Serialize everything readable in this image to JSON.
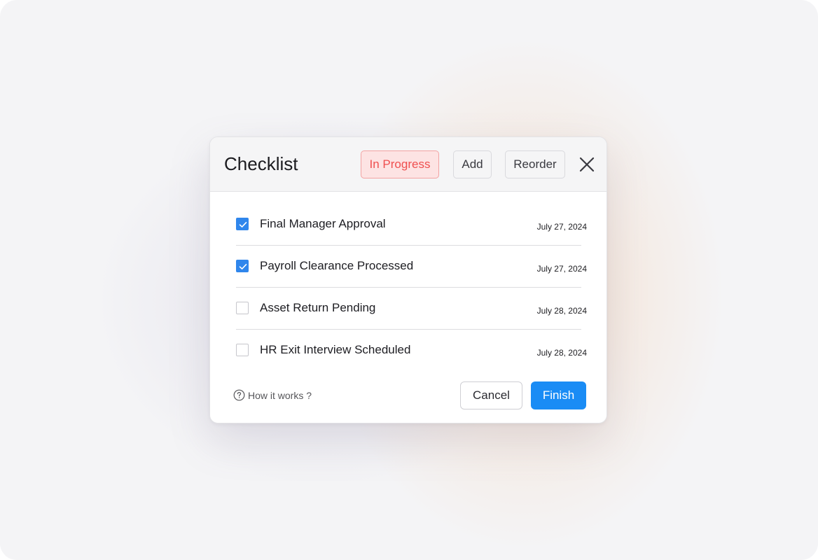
{
  "dialog": {
    "title": "Checklist",
    "status_label": "In Progress",
    "add_label": "Add",
    "reorder_label": "Reorder",
    "close_icon": "close-icon"
  },
  "items": [
    {
      "label": "Final Manager Approval",
      "date": "July 27, 2024",
      "checked": true
    },
    {
      "label": "Payroll Clearance Processed",
      "date": "July 27, 2024",
      "checked": true
    },
    {
      "label": "Asset Return Pending",
      "date": "July 28, 2024",
      "checked": false
    },
    {
      "label": "HR Exit Interview Scheduled",
      "date": "July 28, 2024",
      "checked": false
    }
  ],
  "footer": {
    "help_icon": "question-circle-icon",
    "help_label": "How it works ?",
    "cancel_label": "Cancel",
    "finish_label": "Finish"
  },
  "colors": {
    "accent": "#1a8cf5",
    "checkbox_checked": "#2f86ec",
    "status_text": "#ef4f4f",
    "status_background": "#fde3e3"
  }
}
